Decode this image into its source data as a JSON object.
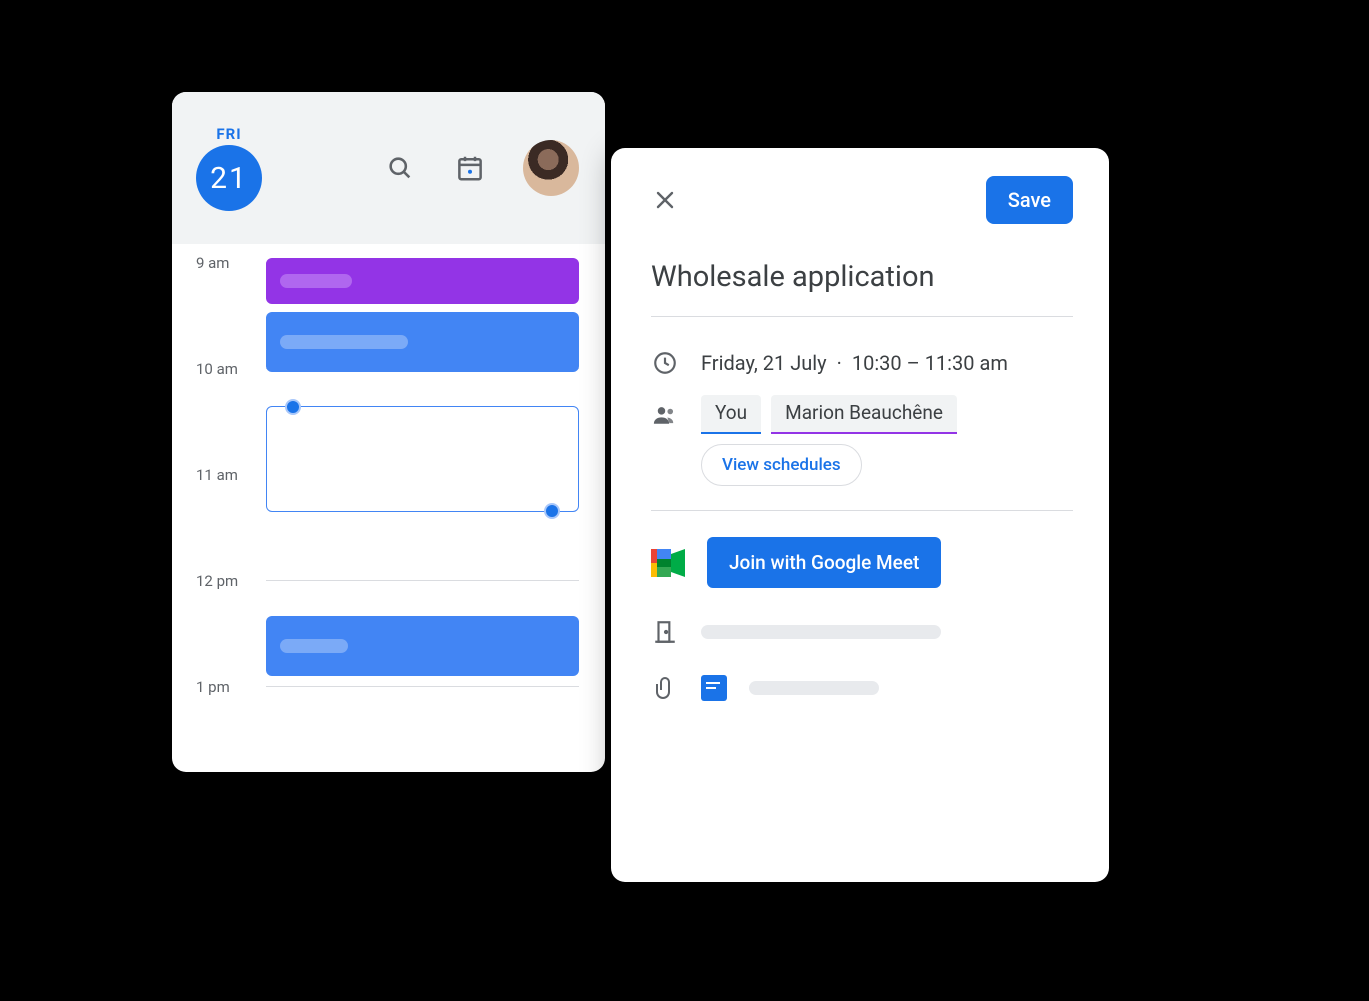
{
  "calendar": {
    "day_name": "FRI",
    "day_number": "21",
    "hours": [
      "9 am",
      "10 am",
      "11 am",
      "12 pm",
      "1 pm"
    ]
  },
  "detail": {
    "save_label": "Save",
    "title": "Wholesale application",
    "date": "Friday, 21 July",
    "time": "10:30 – 11:30 am",
    "you_label": "You",
    "guest_name": "Marion Beauchêne",
    "view_schedules_label": "View schedules",
    "meet_label": "Join with Google Meet"
  }
}
